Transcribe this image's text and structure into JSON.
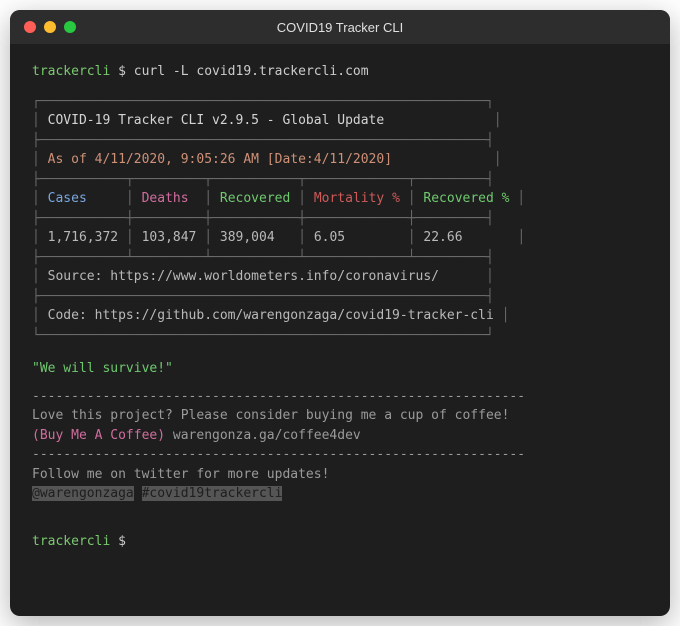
{
  "window": {
    "title": "COVID19 Tracker CLI"
  },
  "prompt": {
    "host": "trackercli",
    "symbol": "$",
    "command": "curl -L covid19.trackercli.com"
  },
  "output": {
    "header": "COVID-19 Tracker CLI v2.9.5 - Global Update",
    "asof": "As of 4/11/2020, 9:05:26 AM [Date:4/11/2020]",
    "columns": {
      "cases": "Cases",
      "deaths": "Deaths",
      "recovered": "Recovered",
      "mortality": "Mortality %",
      "recovered_pct": "Recovered %"
    },
    "values": {
      "cases": "1,716,372",
      "deaths": "103,847",
      "recovered": "389,004",
      "mortality": "6.05",
      "recovered_pct": "22.66"
    },
    "source_label": "Source: ",
    "source_url": "https://www.worldometers.info/coronavirus/",
    "code_label": "Code: ",
    "code_url": "https://github.com/warengonzaga/covid19-tracker-cli"
  },
  "footer": {
    "quote": "\"We will survive!\"",
    "divider": "---------------------------------------------------------------",
    "love_line": "Love this project? Please consider buying me a cup of coffee!",
    "buy_coffee_label": "(Buy Me A Coffee)",
    "buy_coffee_url": "warengonza.ga/coffee4dev",
    "follow_line": "Follow me on twitter for more updates!",
    "twitter_handle": "@warengonzaga",
    "hashtag": "#covid19trackercli"
  }
}
